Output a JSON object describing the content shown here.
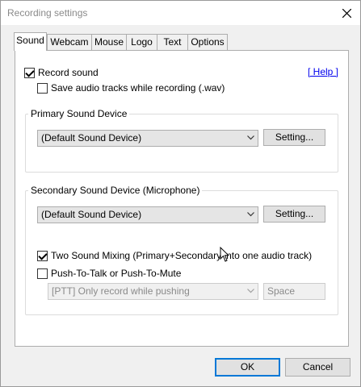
{
  "window": {
    "title": "Recording settings"
  },
  "tabs": [
    {
      "label": "Sound",
      "active": true
    },
    {
      "label": "Webcam",
      "active": false
    },
    {
      "label": "Mouse",
      "active": false
    },
    {
      "label": "Logo",
      "active": false
    },
    {
      "label": "Text",
      "active": false
    },
    {
      "label": "Options",
      "active": false
    }
  ],
  "sound": {
    "record_sound": {
      "label": "Record sound",
      "checked": true
    },
    "save_wav": {
      "label": "Save audio tracks while recording (.wav)",
      "checked": false
    },
    "help_link": "[ Help ]",
    "primary": {
      "group_label": "Primary Sound Device",
      "device": "(Default Sound Device)",
      "setting_button": "Setting..."
    },
    "secondary": {
      "group_label": "Secondary Sound Device (Microphone)",
      "device": "(Default Sound Device)",
      "setting_button": "Setting...",
      "two_sound_mixing": {
        "label": "Two Sound Mixing (Primary+Secondary into one audio track)",
        "checked": true
      },
      "push_to_talk": {
        "label": "Push-To-Talk or Push-To-Mute",
        "checked": false
      },
      "ptt_mode": "[PTT] Only record while pushing",
      "ptt_key": "Space"
    }
  },
  "footer": {
    "ok": "OK",
    "cancel": "Cancel"
  }
}
